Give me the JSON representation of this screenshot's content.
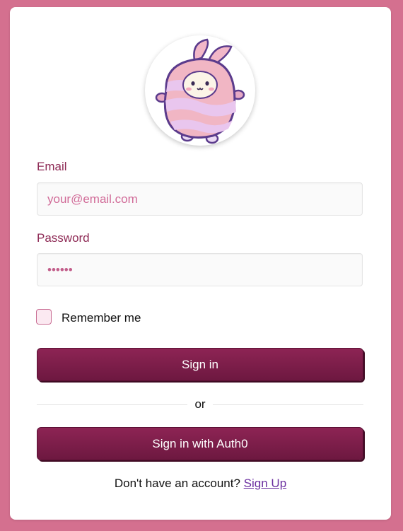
{
  "form": {
    "email_label": "Email",
    "email_placeholder": "your@email.com",
    "email_value": "",
    "password_label": "Password",
    "password_value": "••••••",
    "remember_label": "Remember me",
    "remember_checked": false,
    "sign_in_label": "Sign in",
    "divider_text": "or",
    "auth0_label": "Sign in with Auth0",
    "signup_prompt": "Don't have an account?",
    "signup_link": "Sign Up"
  },
  "colors": {
    "page_background": "#d4708f",
    "card_background": "#ffffff",
    "label_color": "#8e2a55",
    "button_color": "#7a1d48",
    "link_color": "#6b2fa0"
  },
  "icons": {
    "avatar": "pink-bunny-mascot-icon"
  }
}
